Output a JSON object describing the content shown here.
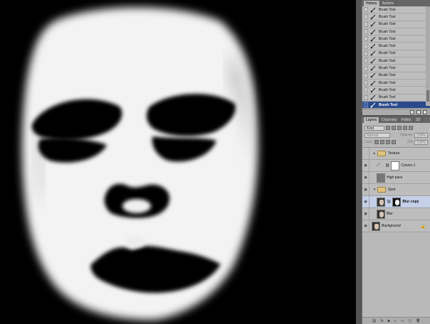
{
  "history": {
    "tabs": [
      "History",
      "Actions"
    ],
    "active_tab": 0,
    "steps": [
      "Brush Tool",
      "Brush Tool",
      "Brush Tool",
      "Brush Tool",
      "Brush Tool",
      "Brush Tool",
      "Brush Tool",
      "Brush Tool",
      "Brush Tool",
      "Brush Tool",
      "Brush Tool",
      "Brush Tool",
      "Brush Tool",
      "Brush Tool"
    ],
    "selected_index": 13
  },
  "layers_panel": {
    "tabs": [
      "Layers",
      "Channels",
      "Paths",
      "3D"
    ],
    "kind": "Kind",
    "blend_mode": "Normal",
    "opacity_label": "Opacity:",
    "opacity_value": "100%",
    "lock_label": "Lock:",
    "fill_label": "Fill:",
    "fill_value": "100%",
    "layers": [
      {
        "name": "Texture",
        "type": "group",
        "visible": false,
        "indent": 0
      },
      {
        "name": "Curves 1",
        "type": "adjustment",
        "visible": true,
        "indent": 1
      },
      {
        "name": "High pass",
        "type": "gray",
        "visible": true,
        "indent": 1
      },
      {
        "name": "Spot",
        "type": "group",
        "visible": true,
        "indent": 0
      },
      {
        "name": "Blur copy",
        "type": "masked",
        "visible": true,
        "indent": 1,
        "selected": true
      },
      {
        "name": "Blur",
        "type": "photo",
        "visible": true,
        "indent": 1
      },
      {
        "name": "Background",
        "type": "photo",
        "visible": true,
        "indent": 0,
        "locked": true
      }
    ],
    "footer_icons": [
      "link-icon",
      "fx-icon",
      "mask-icon",
      "adjustment-icon",
      "folder-icon",
      "new-layer-icon",
      "trash-icon"
    ]
  },
  "colors": {
    "selection_blue": "#2a4a8b",
    "layer_selected": "#c4cfe8",
    "panel_bg": "#b9b9b9"
  }
}
